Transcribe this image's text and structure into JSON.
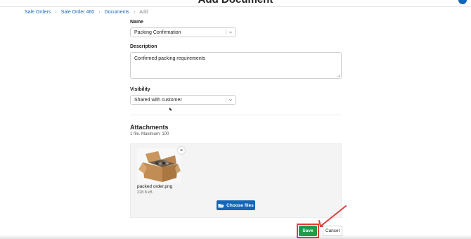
{
  "header": {
    "page_title": "Add Document",
    "breadcrumb": [
      "Sale Orders",
      "Sale Order 460",
      "Documents",
      "Add"
    ]
  },
  "form": {
    "name_label": "Name",
    "name_value": "Packing Confirmation",
    "description_label": "Description",
    "description_value": "Confirmed packing requirements",
    "visibility_label": "Visibility",
    "visibility_value": "Shared with customer"
  },
  "attachments": {
    "title": "Attachments",
    "subtitle": "1 file. Maximum: 100",
    "file_name": "packed order.png",
    "file_size": "228.8 kB",
    "remove_label": "×",
    "choose_label": "Choose files"
  },
  "actions": {
    "save_label": "Save",
    "cancel_label": "Cancel"
  },
  "colors": {
    "link": "#1466b8",
    "save": "#1e9d4a",
    "highlight": "#e23b3b"
  }
}
